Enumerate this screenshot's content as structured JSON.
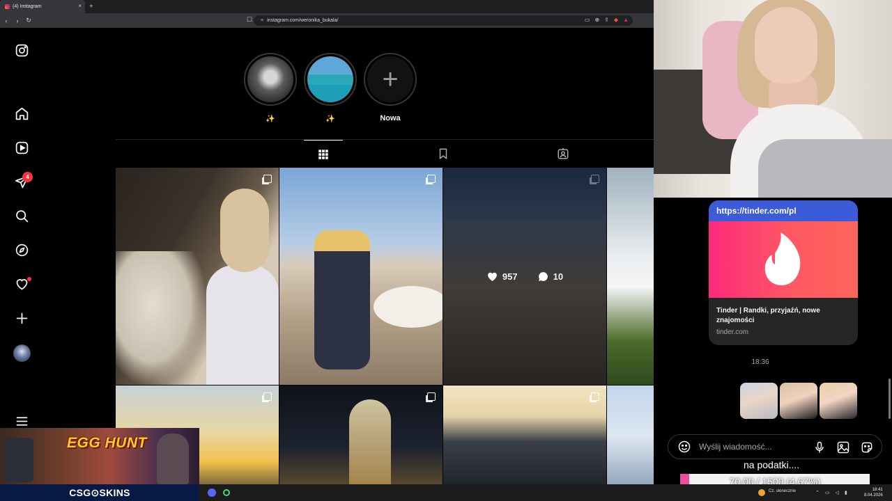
{
  "browser": {
    "tab_title": "(4) Instagram",
    "tab_close": "×",
    "new_tab": "+",
    "url": "instagram.com/weronika_bukala/",
    "back": "‹",
    "forward": "›",
    "reload": "↻"
  },
  "sidebar": {
    "messages_badge": "4",
    "icons": [
      "instagram-icon",
      "home-icon",
      "reels-icon",
      "messages-icon",
      "search-icon",
      "explore-icon",
      "notifications-icon",
      "create-icon",
      "profile-avatar",
      "more-icon"
    ]
  },
  "highlights": [
    {
      "label": "✨"
    },
    {
      "label": "✨"
    },
    {
      "label": "Nowa",
      "symbol": "+"
    }
  ],
  "profile_tabs": [
    "posts-grid-icon",
    "saved-icon",
    "tagged-icon"
  ],
  "posts": {
    "hovered": {
      "likes": "957",
      "comments": "10"
    }
  },
  "chat": {
    "link_card": {
      "url": "https://tinder.com/pl",
      "title": "Tinder | Randki, przyjaźń, nowe znajomości",
      "domain": "tinder.com"
    },
    "time": "18:36",
    "input_placeholder": "Wyślij wiadomość..."
  },
  "overlay": {
    "caption": "na podatki....",
    "progress_text": "70.00 / 1500 (4.67%)",
    "progress_fraction": 0.0467
  },
  "sponsor": {
    "title": "EGG HUNT",
    "brand": "CSG⊙SKINS"
  },
  "taskbar": {
    "weather": "Cz. słonecznie",
    "time": "18:41",
    "date": "8.04.2026"
  },
  "colors": {
    "badge": "#ff3040",
    "tinder_url_bar": "#3b5bd9",
    "progress_fill": "#e94f9e"
  }
}
